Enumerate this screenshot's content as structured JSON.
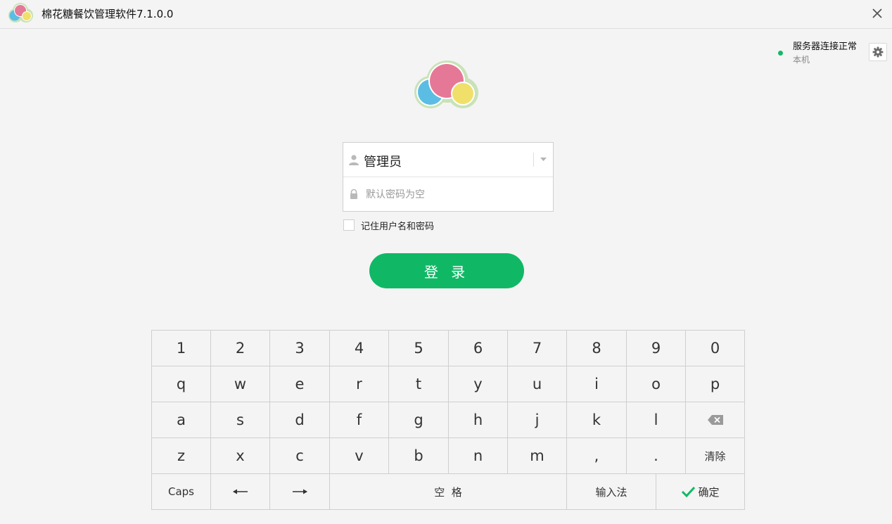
{
  "window": {
    "title": "棉花糖餐饮管理软件7.1.0.0"
  },
  "server": {
    "status": "服务器连接正常",
    "host": "本机",
    "status_color": "#14b866"
  },
  "login": {
    "username": "管理员",
    "password_placeholder": "默认密码为空",
    "password_value": "",
    "remember_label": "记住用户名和密码",
    "remember_checked": false,
    "submit_label": "登 录"
  },
  "colors": {
    "accent": "#10b866",
    "background": "#f4f4f4",
    "border": "#cfcfcf"
  },
  "keyboard": {
    "row1": [
      "1",
      "2",
      "3",
      "4",
      "5",
      "6",
      "7",
      "8",
      "9",
      "0"
    ],
    "row2": [
      "q",
      "w",
      "e",
      "r",
      "t",
      "y",
      "u",
      "i",
      "o",
      "p"
    ],
    "row3": [
      "a",
      "s",
      "d",
      "f",
      "g",
      "h",
      "j",
      "k",
      "l"
    ],
    "row4": [
      "z",
      "x",
      "c",
      "v",
      "b",
      "n",
      "m",
      ",",
      "."
    ],
    "backspace_icon": "backspace-icon",
    "clear_label": "清除",
    "caps_label": "Caps",
    "left_arrow_icon": "arrow-left-icon",
    "right_arrow_icon": "arrow-right-icon",
    "space_label": "空  格",
    "ime_label": "输入法",
    "confirm_label": "确定",
    "confirm_icon": "checkmark-icon"
  }
}
